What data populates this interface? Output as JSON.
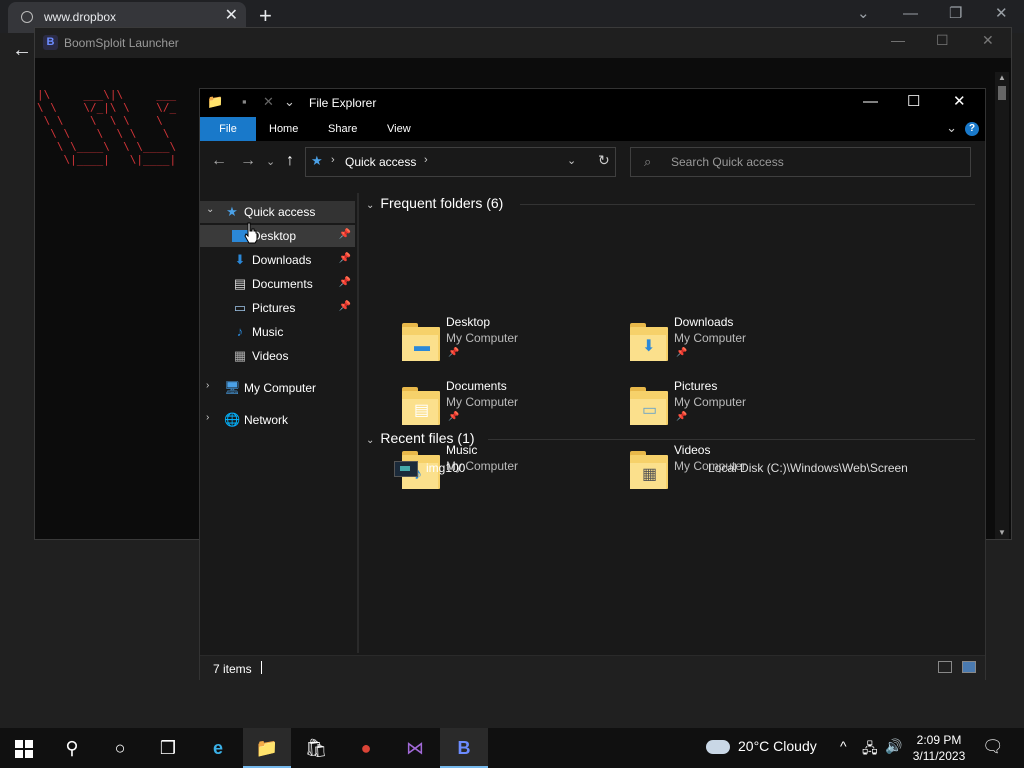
{
  "browser": {
    "tab_title": "www.dropbox",
    "close_glyph": "✕",
    "newtab_glyph": "+",
    "back_glyph": "←",
    "controls": {
      "dropdown": "⌄",
      "minimize": "—",
      "restore": "❐",
      "close": "✕"
    }
  },
  "launcher": {
    "logo": "B",
    "title": "BoomSploit Launcher",
    "controls": {
      "minimize": "—",
      "maximize": "☐",
      "close": "✕"
    },
    "ascii_art": "|\\     ___\\|\\     ___\n\\ \\    \\/_|\\ \\    \\/_\n \\ \\    \\  \\ \\    \\\n  \\ \\    \\  \\ \\    \\\n   \\ \\____\\  \\ \\____\\\n    \\|____|   \\|____|",
    "scroll_up": "▲",
    "scroll_down": "▼"
  },
  "explorer": {
    "title": "File Explorer",
    "quick_access_glyphs": {
      "folder": "📁",
      "props": "▪",
      "delete": "✕",
      "customize": "⌄"
    },
    "controls": {
      "minimize": "—",
      "maximize": "☐",
      "close": "✕"
    },
    "ribbon_tabs": [
      "File",
      "Home",
      "Share",
      "View"
    ],
    "ribbon_expand": "⌄",
    "help": "?",
    "nav": {
      "back": "←",
      "forward": "→",
      "recent": "⌄",
      "up": "↑"
    },
    "address": {
      "separator": "›",
      "location": "Quick access",
      "dropdown": "⌄",
      "refresh": "↻"
    },
    "search": {
      "icon": "⌕",
      "placeholder": "Search Quick access"
    },
    "navpane": {
      "quick_access": "Quick access",
      "items": [
        {
          "label": "Desktop",
          "pinned": true
        },
        {
          "label": "Downloads",
          "pinned": true
        },
        {
          "label": "Documents",
          "pinned": true
        },
        {
          "label": "Pictures",
          "pinned": true
        },
        {
          "label": "Music",
          "pinned": false
        },
        {
          "label": "Videos",
          "pinned": false
        }
      ],
      "my_computer": "My Computer",
      "network": "Network",
      "expand_glyph": "›",
      "collapse_glyph": "⌄",
      "pin_glyph": "📌"
    },
    "frequent": {
      "heading": "Frequent folders (6)",
      "folders": [
        {
          "name": "Desktop",
          "location": "My Computer",
          "pinned": true
        },
        {
          "name": "Downloads",
          "location": "My Computer",
          "pinned": true
        },
        {
          "name": "Documents",
          "location": "My Computer",
          "pinned": true
        },
        {
          "name": "Pictures",
          "location": "My Computer",
          "pinned": true
        },
        {
          "name": "Music",
          "location": "My Computer",
          "pinned": false
        },
        {
          "name": "Videos",
          "location": "My Computer",
          "pinned": false
        }
      ]
    },
    "recent": {
      "heading": "Recent files (1)",
      "files": [
        {
          "name": "img100",
          "path": "Local Disk (C:)\\Windows\\Web\\Screen"
        }
      ]
    },
    "status": {
      "count": "7 items"
    }
  },
  "taskbar": {
    "weather": "20°C  Cloudy",
    "tray": {
      "chevron": "^",
      "network": "🖧",
      "volume": "🔊"
    },
    "time": "2:09 PM",
    "date": "3/11/2023",
    "search_glyph": "⚲",
    "cortana_glyph": "○",
    "taskview_glyph": "❒",
    "notification_glyph": "🗨",
    "apps": {
      "edge": "e",
      "explorer": "📁",
      "store": "🛍",
      "chrome": "●",
      "vs": "⋈",
      "boomsploit": "B"
    }
  }
}
